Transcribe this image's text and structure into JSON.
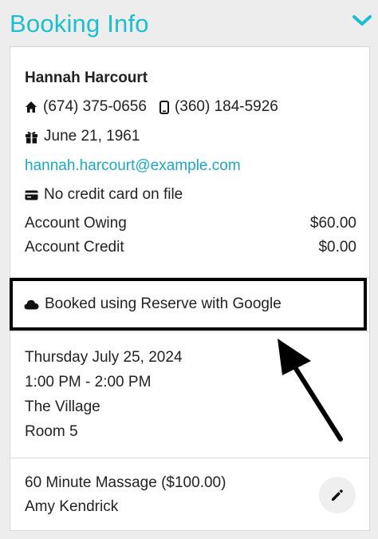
{
  "header": {
    "title": "Booking Info"
  },
  "client": {
    "name": "Hannah Harcourt",
    "home_phone": "(674) 375-0656",
    "mobile_phone": "(360) 184-5926",
    "birthday": "June 21, 1961",
    "email": "hannah.harcourt@example.com",
    "credit_card_status": "No credit card on file"
  },
  "account": {
    "owing_label": "Account Owing",
    "owing_value": "$60.00",
    "credit_label": "Account Credit",
    "credit_value": "$0.00"
  },
  "booking_source": {
    "text": "Booked using Reserve with Google"
  },
  "appointment": {
    "date": "Thursday July 25, 2024",
    "time": "1:00 PM - 2:00 PM",
    "location": "The Village",
    "room": "Room 5"
  },
  "service": {
    "name": "60 Minute Massage ($100.00)",
    "staff": "Amy Kendrick"
  },
  "colors": {
    "accent": "#1bbfd0",
    "link": "#1ba8c7",
    "highlight_border": "#000000"
  },
  "icons": [
    "chevron-down-icon",
    "home-icon",
    "mobile-phone-icon",
    "gift-icon",
    "credit-card-icon",
    "cloud-icon",
    "pencil-icon",
    "arrow-annotation"
  ]
}
